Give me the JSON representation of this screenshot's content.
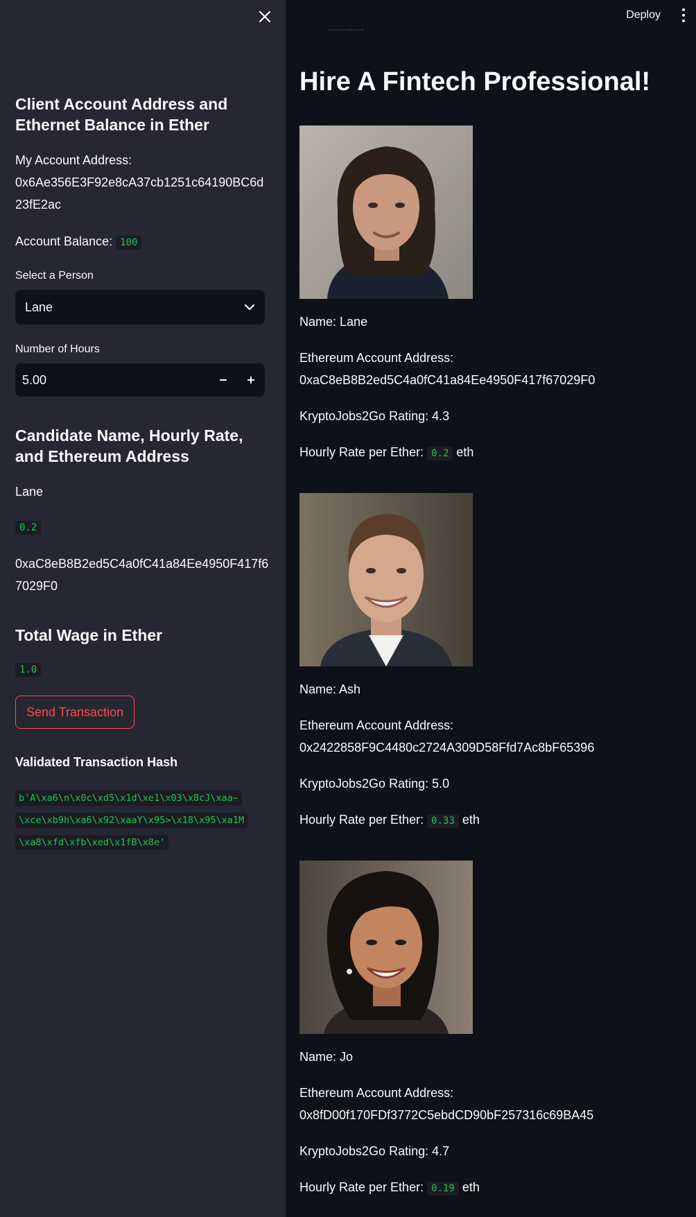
{
  "sidebar": {
    "section1_title": "Client Account Address and Ethernet Balance in Ether",
    "my_account_label": "My Account Address:",
    "my_account_address_line1": "0x6Ae356E3F92e8cA37cb1251c64190BC6d",
    "my_account_address_line2": "23fE2ac",
    "balance_label": "Account Balance:",
    "balance_value": "100",
    "select_label": "Select a Person",
    "select_value": "Lane",
    "hours_label": "Number of Hours",
    "hours_value": "5.00",
    "section2_title": "Candidate Name, Hourly Rate, and Ethereum Address",
    "candidate_name": "Lane",
    "candidate_rate": "0.2",
    "candidate_address_line1": "0xaC8eB8B2ed5C4a0fC41a84Ee4950F417f6",
    "candidate_address_line2": "7029F0",
    "section3_title": "Total Wage in Ether",
    "total_wage": "1.0",
    "send_button": "Send Transaction",
    "hash_title": "Validated Transaction Hash",
    "hash_line1": "b'A\\xa6\\n\\x0c\\xd5\\x1d\\xe1\\x03\\x8cJ\\xaa~",
    "hash_line2": "\\xce\\xb9h\\xa6\\x92\\xaaY\\x95>\\x18\\x95\\xa1M",
    "hash_line3": "\\xa8\\xfd\\xfb\\xed\\x1fB\\x8e'"
  },
  "header": {
    "deploy_label": "Deploy",
    "menu_icon": "kebab-menu-icon"
  },
  "main": {
    "title": "Hire A Fintech Professional!",
    "name_prefix": "Name:",
    "address_label": "Ethereum Account Address:",
    "rating_prefix": "KryptoJobs2Go Rating:",
    "rate_label": "Hourly Rate per Ether:",
    "rate_unit": "eth",
    "candidates": [
      {
        "name": "Lane",
        "address": "0xaC8eB8B2ed5C4a0fC41a84Ee4950F417f67029F0",
        "rating": "4.3",
        "rate": "0.2"
      },
      {
        "name": "Ash",
        "address": "0x2422858F9C4480c2724A309D58Ffd7Ac8bF65396",
        "rating": "5.0",
        "rate": "0.33"
      },
      {
        "name": "Jo",
        "address": "0x8fD00f170FDf3772C5ebdCD90bF257316c69BA45",
        "rating": "4.7",
        "rate": "0.19"
      }
    ]
  },
  "colors": {
    "sidebar_bg": "#262730",
    "main_bg": "#0e1117",
    "accent_red": "#ff4b4b",
    "code_green": "#21c354"
  }
}
